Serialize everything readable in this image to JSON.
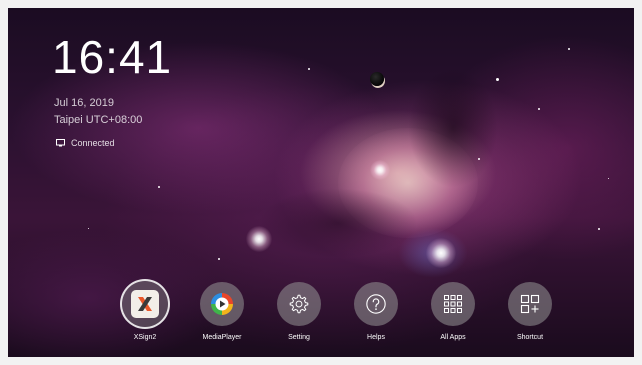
{
  "clock": {
    "time": "16:41",
    "date": "Jul 16, 2019",
    "timezone": "Taipei  UTC+08:00"
  },
  "network": {
    "status": "Connected",
    "icon": "monitor-icon"
  },
  "dock": {
    "apps": [
      {
        "label": "XSign2",
        "icon": "xsign-icon",
        "selected": true
      },
      {
        "label": "MediaPlayer",
        "icon": "play-icon",
        "selected": false
      },
      {
        "label": "Setting",
        "icon": "gear-icon",
        "selected": false
      },
      {
        "label": "Helps",
        "icon": "help-icon",
        "selected": false
      },
      {
        "label": "All Apps",
        "icon": "apps-grid-icon",
        "selected": false
      },
      {
        "label": "Shortcut",
        "icon": "shortcut-add-icon",
        "selected": false
      }
    ]
  },
  "colors": {
    "xsign_orange": "#e8572a",
    "xsign_tile": "#f2eee8",
    "dock_circle": "#969696"
  }
}
